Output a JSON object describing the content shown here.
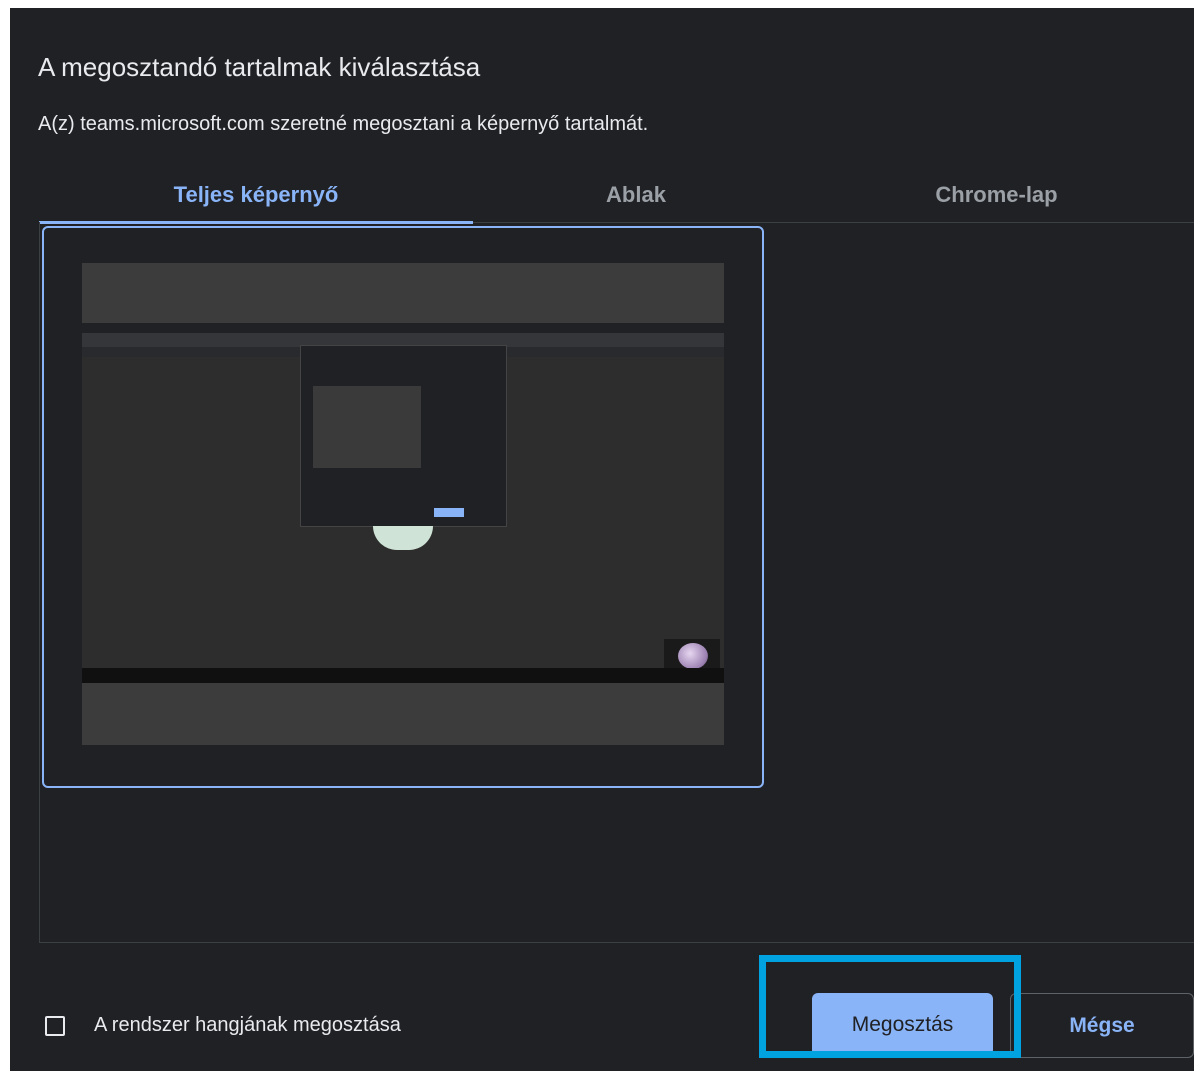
{
  "dialog": {
    "title": "A megosztandó tartalmak kiválasztása",
    "subtitle": "A(z) teams.microsoft.com szeretné megosztani a képernyő tartalmát."
  },
  "tabs": [
    {
      "label": "Teljes képernyő",
      "active": true
    },
    {
      "label": "Ablak",
      "active": false
    },
    {
      "label": "Chrome-lap",
      "active": false
    }
  ],
  "footer": {
    "audio_checkbox_label": "A rendszer hangjának megosztása",
    "audio_checked": false,
    "share_button": "Megosztás",
    "cancel_button": "Mégse"
  },
  "colors": {
    "dialog_bg": "#202124",
    "accent": "#8ab4f8",
    "highlight": "#00a3e0"
  }
}
